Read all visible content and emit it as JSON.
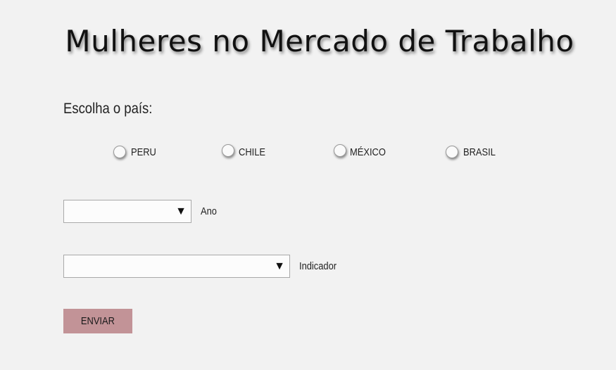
{
  "page": {
    "title": "Mulheres no Mercado de Trabalho"
  },
  "form": {
    "country_prompt": "Escolha o país:",
    "countries": [
      {
        "label": "PERU",
        "selected": false
      },
      {
        "label": "CHILE",
        "selected": false
      },
      {
        "label": "MÉXICO",
        "selected": false
      },
      {
        "label": "BRASIL",
        "selected": false
      }
    ],
    "year_select": {
      "label": "Ano",
      "value": ""
    },
    "indicator_select": {
      "label": "Indicador",
      "value": ""
    },
    "submit_label": "ENVIAR"
  },
  "icons": {
    "dropdown": "triangle-down-icon"
  },
  "colors": {
    "background": "#f2f2f2",
    "button": "#c29397"
  }
}
